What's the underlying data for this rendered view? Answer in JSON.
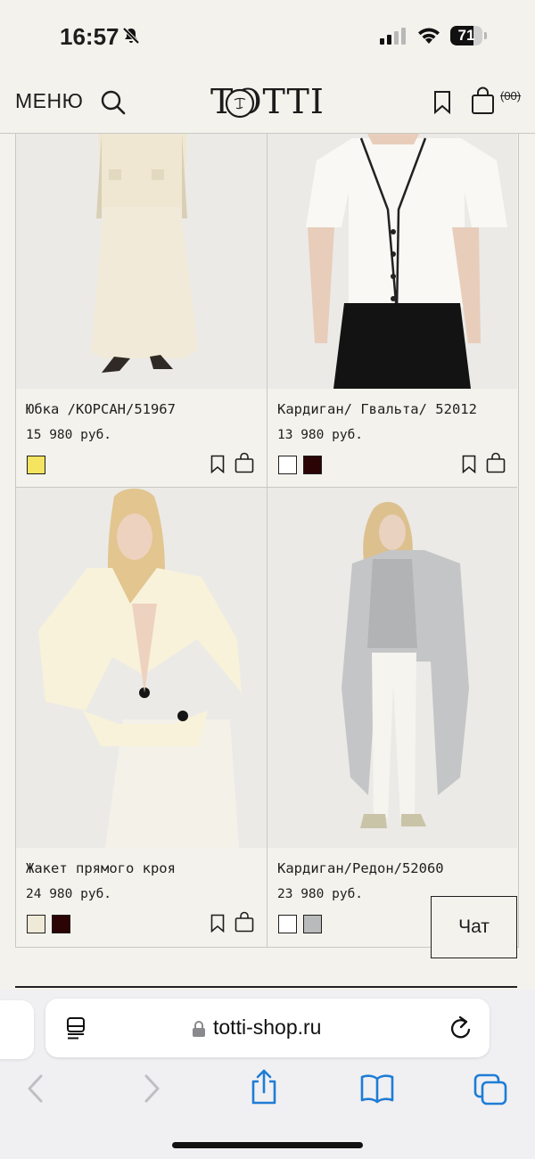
{
  "status_bar": {
    "time": "16:57",
    "battery": "71",
    "battery_level": 0.71
  },
  "header": {
    "menu_label": "МЕНЮ",
    "logo_text": "TOTTI",
    "cart_count": "(00)"
  },
  "products": [
    {
      "name": "Юбка /КОРСАН/51967",
      "price": "15 980 руб.",
      "swatches": [
        "#f4e45f"
      ]
    },
    {
      "name": "Кардиган/ Гвальта/ 52012",
      "price": "13 980 руб.",
      "swatches": [
        "#ffffff",
        "#2b0406"
      ]
    },
    {
      "name": "Жакет прямого кроя",
      "price": "24 980 руб.",
      "swatches": [
        "#efe9d7",
        "#2b0406"
      ]
    },
    {
      "name": "Кардиган/Редон/52060",
      "price": "23 980 руб.",
      "swatches": [
        "#ffffff",
        "#b9babb"
      ]
    }
  ],
  "chat": {
    "label": "Чат"
  },
  "browser": {
    "url": "totti-shop.ru"
  },
  "colors": {
    "background": "#f3f2ec",
    "system_blue": "#1e7cd6"
  }
}
